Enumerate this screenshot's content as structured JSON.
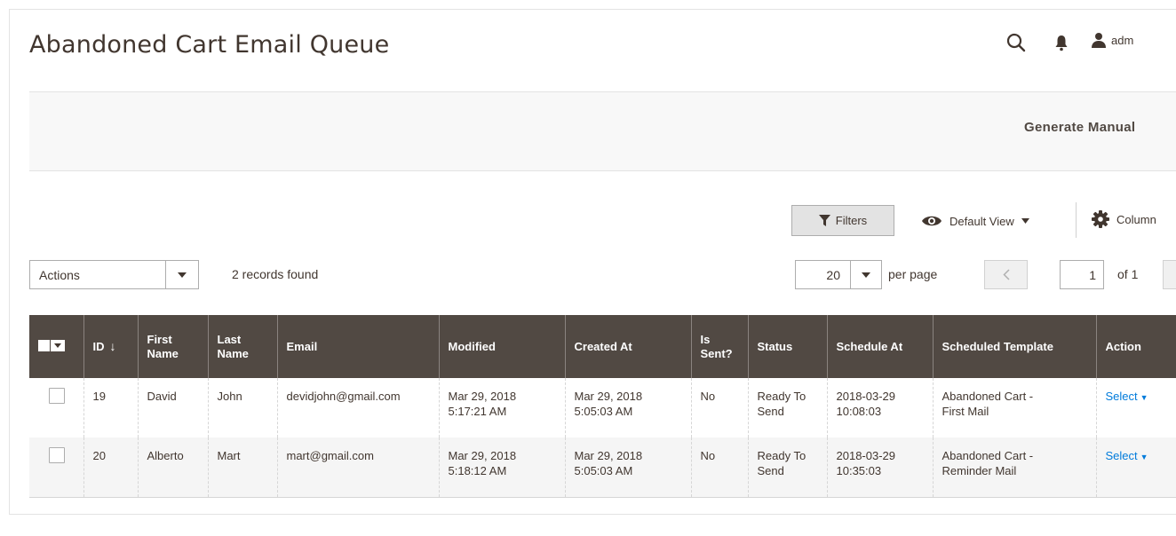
{
  "page": {
    "title": "Abandoned Cart Email Queue",
    "admin_label": "adm",
    "generate_label": "Generate Manual"
  },
  "toolbar": {
    "filters_label": "Filters",
    "view_label": "Default View",
    "columns_label": "Column",
    "actions_value": "Actions",
    "records_found": "2 records found",
    "per_page_value": "20",
    "per_page_label": "per page",
    "page_number": "1",
    "of_pages": "of 1"
  },
  "table": {
    "headers": {
      "id": "ID",
      "sort_arrow": "↓",
      "first_name": "First Name",
      "last_name": "Last Name",
      "email": "Email",
      "modified": "Modified",
      "created_at": "Created At",
      "is_sent": "Is Sent?",
      "status": "Status",
      "schedule_at": "Schedule At",
      "scheduled_template": "Scheduled Template",
      "action": "Action"
    },
    "rows": [
      {
        "id": "19",
        "first_name": "David",
        "last_name": "John",
        "email": "devidjohn@gmail.com",
        "modified_date": "Mar 29, 2018",
        "modified_time": "5:17:21 AM",
        "created_date": "Mar 29, 2018",
        "created_time": "5:05:03 AM",
        "is_sent": "No",
        "status_1": "Ready To",
        "status_2": "Send",
        "schedule_date": "2018-03-29",
        "schedule_time": "10:08:03",
        "template_1": "Abandoned Cart -",
        "template_2": "First Mail",
        "action": "Select"
      },
      {
        "id": "20",
        "first_name": "Alberto",
        "last_name": "Mart",
        "email": "mart@gmail.com",
        "modified_date": "Mar 29, 2018",
        "modified_time": "5:18:12 AM",
        "created_date": "Mar 29, 2018",
        "created_time": "5:05:03 AM",
        "is_sent": "No",
        "status_1": "Ready To",
        "status_2": "Send",
        "schedule_date": "2018-03-29",
        "schedule_time": "10:35:03",
        "template_1": "Abandoned Cart -",
        "template_2": "Reminder Mail",
        "action": "Select"
      }
    ]
  },
  "colors": {
    "header_bg": "#514943",
    "link": "#007bdb",
    "text": "#41362f",
    "even_row": "#f5f5f5"
  },
  "icons": [
    "search-icon",
    "bell-icon",
    "user-icon",
    "filter-icon",
    "eye-icon",
    "gear-icon",
    "chevron-left-icon",
    "caret-down-icon"
  ]
}
